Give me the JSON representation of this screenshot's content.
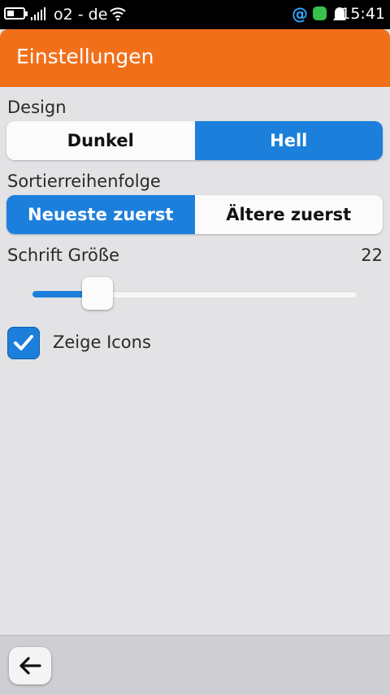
{
  "status_bar": {
    "carrier": "o2 - de",
    "time": "15:41",
    "icons": [
      "battery-icon",
      "signal-icon",
      "wifi-icon",
      "email-notification-icon",
      "chat-notification-icon",
      "bell-icon"
    ]
  },
  "header": {
    "title": "Einstellungen",
    "color": "#f26f19"
  },
  "design": {
    "label": "Design",
    "options": [
      "Dunkel",
      "Hell"
    ],
    "selected": "Hell"
  },
  "sort": {
    "label": "Sortierreihenfolge",
    "options": [
      "Neueste zuerst",
      "Ältere zuerst"
    ],
    "selected": "Neueste zuerst"
  },
  "font_size": {
    "label": "Schrift Größe",
    "value": "22",
    "slider_fraction": 0.2
  },
  "show_icons": {
    "label": "Zeige Icons",
    "checked": true
  },
  "toolbar": {
    "back_icon": "back-arrow-icon"
  },
  "colors": {
    "accent": "#1c7fdb",
    "background": "#e3e3e6"
  }
}
